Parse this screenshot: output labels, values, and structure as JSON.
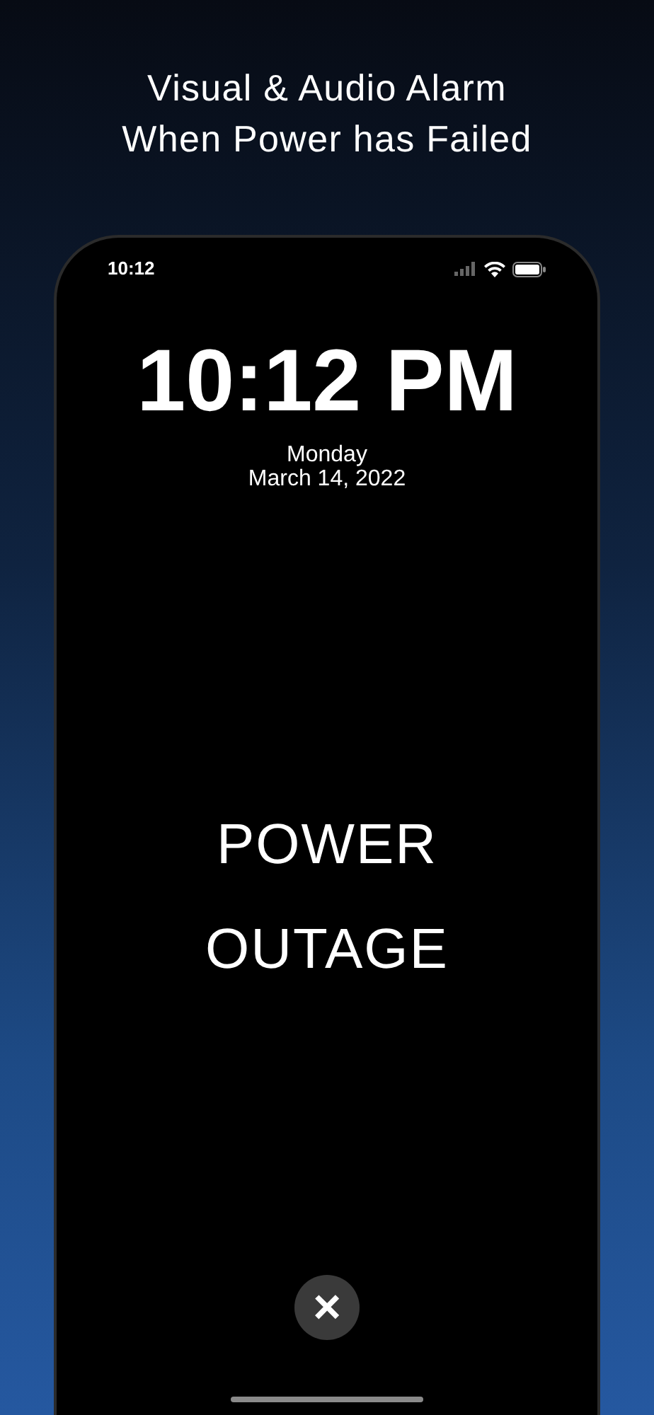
{
  "caption": [
    "Visual & Audio Alarm",
    "When Power has Failed"
  ],
  "status_bar": {
    "time": "10:12"
  },
  "clock": {
    "time": "10:12 PM",
    "day": "Monday",
    "date": "March 14, 2022"
  },
  "alert": [
    "POWER",
    "OUTAGE"
  ],
  "close_button": {
    "label": "×"
  }
}
